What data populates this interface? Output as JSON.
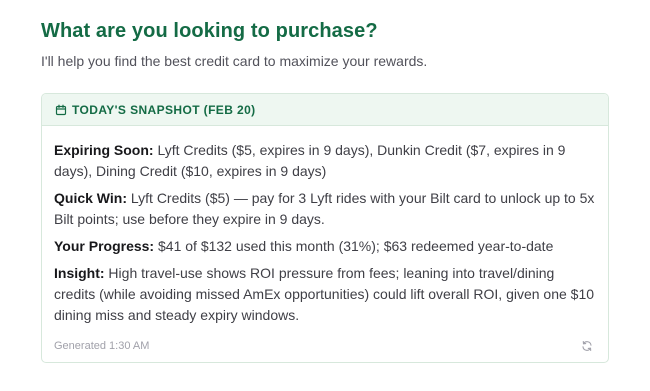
{
  "header": {
    "title": "What are you looking to purchase?",
    "subtitle": "I'll help you find the best credit card to maximize your rewards."
  },
  "snapshot": {
    "icon": "calendar-icon",
    "heading": "TODAY'S SNAPSHOT (FEB 20)",
    "items": [
      {
        "label": "Expiring Soon:",
        "text": " Lyft Credits ($5, expires in 9 days), Dunkin Credit ($7, expires in 9 days), Dining Credit ($10, expires in 9 days)"
      },
      {
        "label": "Quick Win:",
        "text": " Lyft Credits ($5) — pay for 3 Lyft rides with your Bilt card to unlock up to 5x Bilt points; use before they expire in 9 days."
      },
      {
        "label": "Your Progress:",
        "text": " $41 of $132 used this month (31%); $63 redeemed year-to-date"
      },
      {
        "label": "Insight:",
        "text": " High travel-use shows ROI pressure from fees; leaning into travel/dining credits (while avoiding missed AmEx opportunities) could lift overall ROI, given one $10 dining miss and steady expiry windows."
      }
    ],
    "generated": "Generated 1:30 AM",
    "refresh_icon": "refresh-icon"
  },
  "colors": {
    "accent": "#146b45",
    "header_bg": "#eef7f1",
    "border": "#d7e8dc"
  }
}
